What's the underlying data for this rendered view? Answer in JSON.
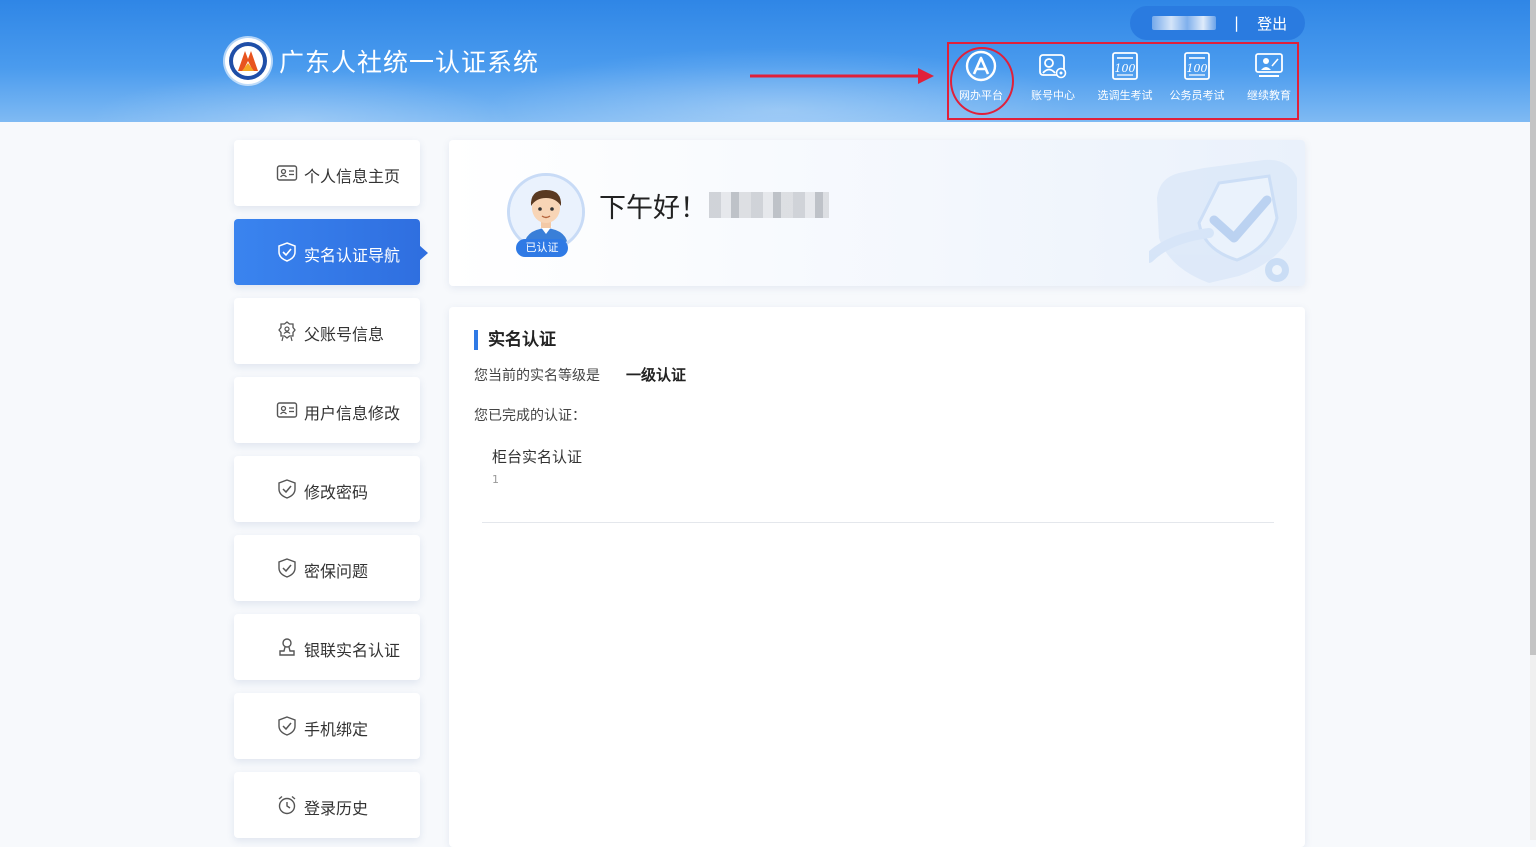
{
  "header": {
    "title": "广东人社统一认证系统",
    "separator": "|",
    "logout_label": "登出",
    "apps": [
      {
        "label": "网办平台",
        "icon": "office-platform-icon"
      },
      {
        "label": "账号中心",
        "icon": "account-center-icon"
      },
      {
        "label": "选调生考试",
        "icon": "exam-100-icon"
      },
      {
        "label": "公务员考试",
        "icon": "exam-100-icon"
      },
      {
        "label": "继续教育",
        "icon": "education-icon"
      }
    ]
  },
  "sidebar": {
    "items": [
      {
        "label": "个人信息主页",
        "icon": "id-card-icon"
      },
      {
        "label": "实名认证导航",
        "icon": "shield-check-icon",
        "active": true
      },
      {
        "label": "父账号信息",
        "icon": "badge-icon"
      },
      {
        "label": "用户信息修改",
        "icon": "id-card-icon"
      },
      {
        "label": "修改密码",
        "icon": "shield-check-icon"
      },
      {
        "label": "密保问题",
        "icon": "shield-check-icon"
      },
      {
        "label": "银联实名认证",
        "icon": "user-stamp-icon"
      },
      {
        "label": "手机绑定",
        "icon": "shield-check-icon"
      },
      {
        "label": "登录历史",
        "icon": "alarm-clock-icon"
      }
    ]
  },
  "greeting": {
    "text": "下午好！",
    "verified_badge": "已认证"
  },
  "realname": {
    "section_title": "实名认证",
    "level_label": "您当前的实名等级是",
    "level_value": "一级认证",
    "completed_label": "您已完成的认证：",
    "certifications": [
      {
        "name": "柜台实名认证",
        "count": "1"
      }
    ]
  },
  "colors": {
    "header_blue": "#2f86e6",
    "active_blue": "#2f6fe0",
    "highlight_red": "#e0203a"
  }
}
